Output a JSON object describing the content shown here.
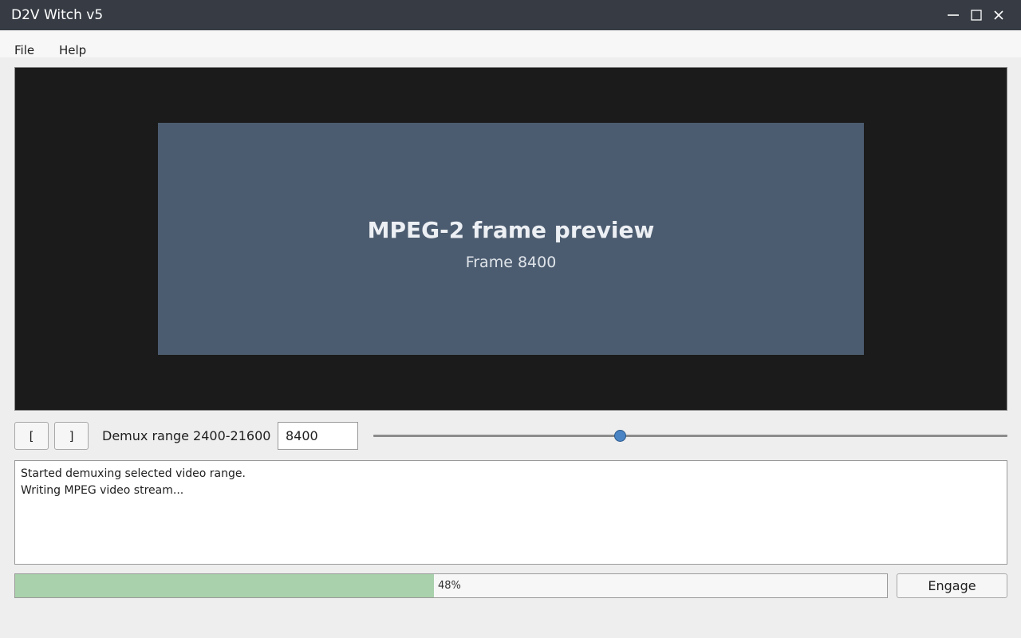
{
  "window": {
    "title": "D2V Witch v5",
    "minimize_icon": "minimize-icon",
    "maximize_icon": "maximize-icon",
    "close_icon": "close-icon"
  },
  "menubar": {
    "file": "File",
    "help": "Help"
  },
  "preview": {
    "title": "MPEG-2 frame preview",
    "subtitle": "Frame 8400"
  },
  "controls": {
    "range_start_button": "[",
    "range_end_button": "]",
    "range_label": "Demux range 2400-21600",
    "frame_value": "8400",
    "slider_fraction": 0.389
  },
  "log": {
    "lines": [
      "Started demuxing selected video range.",
      "Writing MPEG video stream..."
    ]
  },
  "progress": {
    "percent": 48,
    "label": "48%"
  },
  "engage_button": "Engage",
  "colors": {
    "titlebar": "#373c44",
    "preview_background": "#1b1b1b",
    "frame": "#4c5c70",
    "slider_handle": "#4a84c4",
    "progress_fill": "#a9d1ab"
  }
}
